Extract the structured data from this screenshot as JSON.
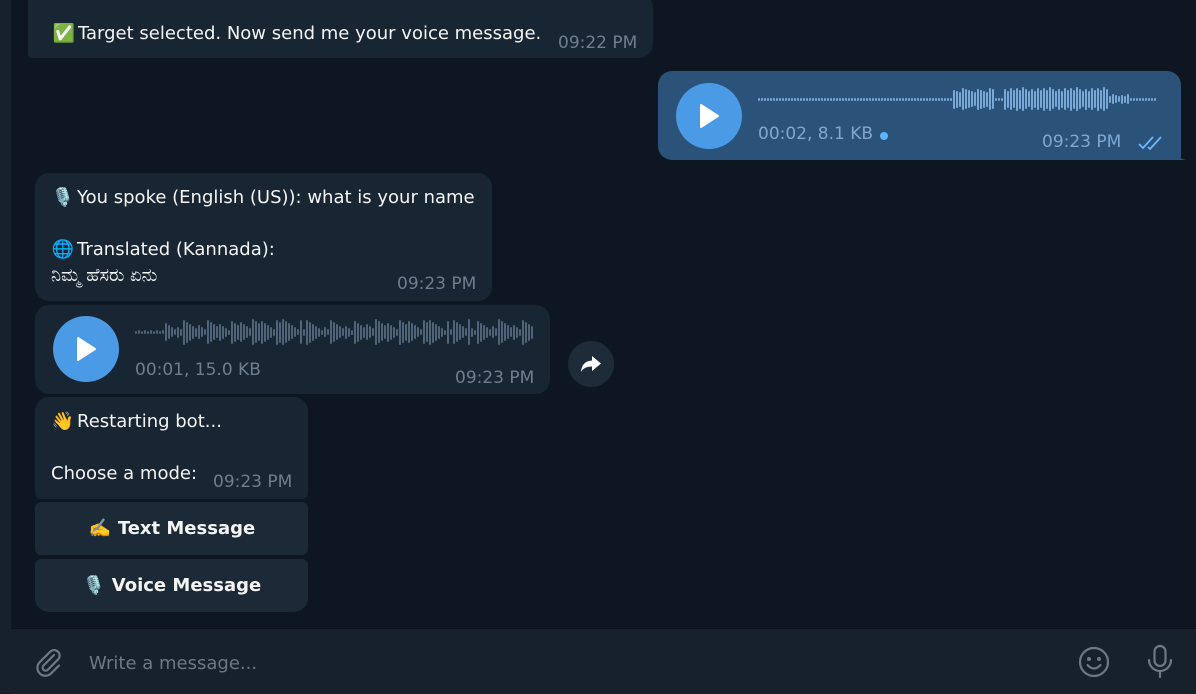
{
  "messages": {
    "target": {
      "emoji": "✅",
      "text": "Target selected. Now send me your voice message.",
      "time": "09:22 PM"
    },
    "outgoing_voice": {
      "duration_size": "00:02, 8.1 KB",
      "time": "09:23 PM",
      "status": "read",
      "unplayed_dot": true
    },
    "transcript": {
      "line1_emoji": "🎙️",
      "line1": "You spoke (English (US)): what is your name",
      "line2_emoji": "🌐",
      "line2": "Translated (Kannada):",
      "line3": "ನಿಮ್ಮ ಹೆಸರು ಏನು",
      "time": "09:23 PM"
    },
    "incoming_voice": {
      "duration_size": "00:01, 15.0 KB",
      "time": "09:23 PM"
    },
    "restart": {
      "emoji": "👋",
      "line1": "Restarting bot...",
      "line2": "Choose a mode:",
      "time": "09:23 PM"
    }
  },
  "keyboard": {
    "text_message": {
      "emoji": "✍️",
      "label": "Text Message"
    },
    "voice_message": {
      "emoji": "🎙️",
      "label": "Voice Message"
    }
  },
  "composer": {
    "placeholder": "Write a message..."
  },
  "colors": {
    "background": "#0e1621",
    "incoming_bubble": "#182533",
    "outgoing_bubble": "#2b5278",
    "accent": "#4a9ae5",
    "timestamp": "#6d7f8f"
  },
  "icons": [
    "play-icon",
    "share-icon",
    "attach-icon",
    "emoji-icon",
    "mic-icon",
    "double-check-icon"
  ]
}
